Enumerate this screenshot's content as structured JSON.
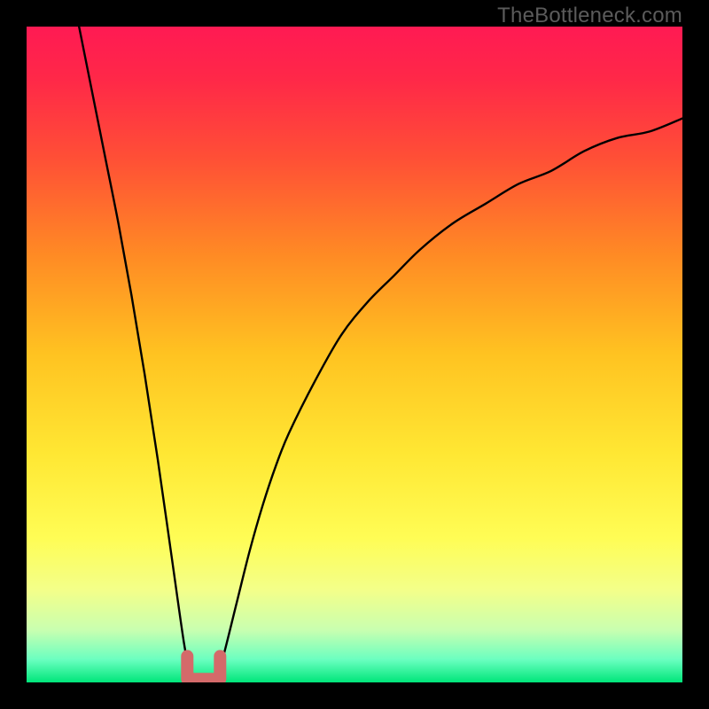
{
  "watermark": "TheBottleneck.com",
  "gradient_stops": [
    {
      "offset": 0.0,
      "color": "#ff1a53"
    },
    {
      "offset": 0.08,
      "color": "#ff2848"
    },
    {
      "offset": 0.2,
      "color": "#ff4f36"
    },
    {
      "offset": 0.35,
      "color": "#ff8b24"
    },
    {
      "offset": 0.5,
      "color": "#ffc321"
    },
    {
      "offset": 0.65,
      "color": "#ffe733"
    },
    {
      "offset": 0.78,
      "color": "#fffd55"
    },
    {
      "offset": 0.86,
      "color": "#f3ff8a"
    },
    {
      "offset": 0.92,
      "color": "#c9ffb0"
    },
    {
      "offset": 0.965,
      "color": "#6bffc0"
    },
    {
      "offset": 1.0,
      "color": "#00e67a"
    }
  ],
  "chart_data": {
    "type": "line",
    "title": "",
    "xlabel": "",
    "ylabel": "",
    "x_range": [
      0,
      100
    ],
    "y_range": [
      0,
      100
    ],
    "notes": "V-shaped bottleneck curve. Minimum (≈0) around x≈25–29. Left branch starts near y=100 at x≈8 and falls steeply. Right branch rises asymptotically toward y≈86 by x=100. Small red U-shaped highlight marks the trough.",
    "series": [
      {
        "name": "left-branch",
        "x": [
          8,
          10,
          12,
          14,
          16,
          18,
          20,
          22,
          24,
          25
        ],
        "values": [
          100,
          90,
          80,
          70,
          59,
          47,
          34,
          20,
          6,
          1
        ]
      },
      {
        "name": "right-branch",
        "x": [
          29,
          30,
          32,
          34,
          36,
          38,
          40,
          44,
          48,
          52,
          56,
          60,
          65,
          70,
          75,
          80,
          85,
          90,
          95,
          100
        ],
        "values": [
          1,
          4,
          12,
          20,
          27,
          33,
          38,
          46,
          53,
          58,
          62,
          66,
          70,
          73,
          76,
          78,
          81,
          83,
          84,
          86
        ]
      }
    ],
    "trough_highlight": {
      "x_start": 24.5,
      "x_end": 29.5,
      "y_floor": 0.5,
      "y_top": 4,
      "color": "#d46a6a"
    }
  }
}
